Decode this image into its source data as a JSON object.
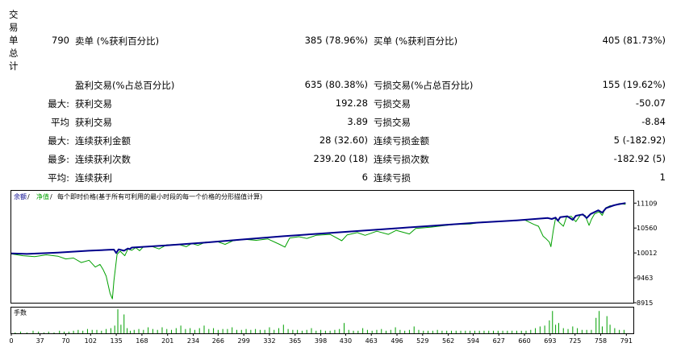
{
  "summary": {
    "vertical_label": [
      "交",
      "易",
      "单",
      "总",
      "计"
    ],
    "total_trades": "790",
    "short_label": "卖单 (%获利百分比)",
    "short_value": "385 (78.96%)",
    "long_label": "买单 (%获利百分比)",
    "long_value": "405 (81.73%)",
    "profit_trades_label": "盈利交易(%占总百分比)",
    "profit_trades_value": "635 (80.38%)",
    "loss_trades_label": "亏损交易(%占总百分比)",
    "loss_trades_value": "155 (19.62%)",
    "rows": [
      {
        "prefix": "最大:",
        "l_label": "获利交易",
        "l_value": "192.28",
        "r_label": "亏损交易",
        "r_value": "-50.07"
      },
      {
        "prefix": "平均",
        "l_label": "获利交易",
        "l_value": "3.89",
        "r_label": "亏损交易",
        "r_value": "-8.84"
      },
      {
        "prefix": "最大:",
        "l_label": "连续获利金额",
        "l_value": "28 (32.60)",
        "r_label": "连续亏损金额",
        "r_value": "5 (-182.92)"
      },
      {
        "prefix": "最多:",
        "l_label": "连续获利次数",
        "l_value": "239.20 (18)",
        "r_label": "连续亏损次数",
        "r_value": "-182.92 (5)"
      },
      {
        "prefix": "平均:",
        "l_label": "连续获利",
        "l_value": "6",
        "r_label": "连续亏损",
        "r_value": "1"
      }
    ]
  },
  "chart_data": [
    {
      "type": "line",
      "legend": {
        "balance": "余额",
        "sep1": " / ",
        "equity": "净值",
        "sep2": " / ",
        "note": "每个即时价格(基于所有可利用的最小时段的每一个价格的分形描值计算)"
      },
      "colors": {
        "balance": "#00008b",
        "equity": "#00a000",
        "axis_text": "#000000",
        "grid": "#c8c8c8"
      },
      "ylim": [
        8915,
        11380
      ],
      "yticks": [
        11109,
        10560,
        10012,
        9463,
        8915
      ],
      "x_range": [
        0,
        800
      ],
      "series": [
        {
          "name": "余额",
          "points": [
            [
              0,
              10000
            ],
            [
              20,
              9990
            ],
            [
              60,
              10020
            ],
            [
              100,
              10060
            ],
            [
              125,
              10080
            ],
            [
              132,
              10085
            ],
            [
              135,
              10010
            ],
            [
              138,
              10090
            ],
            [
              145,
              10060
            ],
            [
              150,
              10110
            ],
            [
              152,
              10095
            ],
            [
              155,
              10130
            ],
            [
              200,
              10180
            ],
            [
              250,
              10240
            ],
            [
              300,
              10310
            ],
            [
              350,
              10380
            ],
            [
              400,
              10440
            ],
            [
              450,
              10500
            ],
            [
              500,
              10560
            ],
            [
              550,
              10620
            ],
            [
              600,
              10680
            ],
            [
              650,
              10730
            ],
            [
              690,
              10780
            ],
            [
              695,
              10760
            ],
            [
              700,
              10790
            ],
            [
              703,
              10720
            ],
            [
              706,
              10800
            ],
            [
              715,
              10820
            ],
            [
              722,
              10740
            ],
            [
              726,
              10830
            ],
            [
              735,
              10860
            ],
            [
              740,
              10780
            ],
            [
              745,
              10870
            ],
            [
              755,
              10950
            ],
            [
              760,
              10900
            ],
            [
              765,
              11000
            ],
            [
              775,
              11060
            ],
            [
              780,
              11080
            ],
            [
              790,
              11110
            ]
          ]
        },
        {
          "name": "净值",
          "points": [
            [
              0,
              9990
            ],
            [
              15,
              9950
            ],
            [
              30,
              9930
            ],
            [
              45,
              9970
            ],
            [
              60,
              9940
            ],
            [
              70,
              9880
            ],
            [
              80,
              9900
            ],
            [
              90,
              9800
            ],
            [
              100,
              9850
            ],
            [
              108,
              9700
            ],
            [
              114,
              9760
            ],
            [
              118,
              9650
            ],
            [
              122,
              9500
            ],
            [
              127,
              9120
            ],
            [
              130,
              9000
            ],
            [
              132,
              9400
            ],
            [
              136,
              9980
            ],
            [
              140,
              10050
            ],
            [
              146,
              9950
            ],
            [
              150,
              10100
            ],
            [
              155,
              10070
            ],
            [
              160,
              10130
            ],
            [
              165,
              10060
            ],
            [
              170,
              10150
            ],
            [
              180,
              10160
            ],
            [
              190,
              10100
            ],
            [
              200,
              10190
            ],
            [
              215,
              10200
            ],
            [
              225,
              10150
            ],
            [
              232,
              10220
            ],
            [
              240,
              10180
            ],
            [
              250,
              10250
            ],
            [
              265,
              10260
            ],
            [
              275,
              10200
            ],
            [
              285,
              10280
            ],
            [
              300,
              10310
            ],
            [
              315,
              10290
            ],
            [
              330,
              10320
            ],
            [
              345,
              10200
            ],
            [
              352,
              10140
            ],
            [
              358,
              10340
            ],
            [
              370,
              10370
            ],
            [
              380,
              10330
            ],
            [
              392,
              10400
            ],
            [
              410,
              10420
            ],
            [
              425,
              10280
            ],
            [
              432,
              10410
            ],
            [
              445,
              10460
            ],
            [
              455,
              10400
            ],
            [
              470,
              10490
            ],
            [
              485,
              10420
            ],
            [
              495,
              10510
            ],
            [
              512,
              10430
            ],
            [
              520,
              10550
            ],
            [
              540,
              10580
            ],
            [
              555,
              10610
            ],
            [
              570,
              10640
            ],
            [
              590,
              10650
            ],
            [
              605,
              10690
            ],
            [
              620,
              10700
            ],
            [
              640,
              10720
            ],
            [
              660,
              10740
            ],
            [
              672,
              10640
            ],
            [
              678,
              10600
            ],
            [
              684,
              10380
            ],
            [
              688,
              10320
            ],
            [
              692,
              10250
            ],
            [
              694,
              10150
            ],
            [
              697,
              10500
            ],
            [
              700,
              10780
            ],
            [
              705,
              10680
            ],
            [
              710,
              10600
            ],
            [
              714,
              10800
            ],
            [
              720,
              10820
            ],
            [
              726,
              10700
            ],
            [
              732,
              10850
            ],
            [
              738,
              10840
            ],
            [
              743,
              10620
            ],
            [
              746,
              10750
            ],
            [
              750,
              10870
            ],
            [
              756,
              10920
            ],
            [
              760,
              10840
            ],
            [
              764,
              11000
            ],
            [
              770,
              11050
            ],
            [
              776,
              11060
            ],
            [
              782,
              11100
            ],
            [
              790,
              11080
            ]
          ]
        }
      ],
      "xticks": [
        "0",
        "37",
        "70",
        "102",
        "135",
        "168",
        "201",
        "234",
        "266",
        "299",
        "332",
        "365",
        "398",
        "430",
        "463",
        "496",
        "529",
        "562",
        "594",
        "627",
        "660",
        "693",
        "725",
        "758",
        "791"
      ]
    },
    {
      "type": "bar",
      "title": "手数",
      "color": "#00a000",
      "bars": [
        [
          5,
          1
        ],
        [
          12,
          2
        ],
        [
          20,
          1
        ],
        [
          28,
          3
        ],
        [
          35,
          2
        ],
        [
          42,
          1
        ],
        [
          48,
          2
        ],
        [
          55,
          1
        ],
        [
          62,
          3
        ],
        [
          68,
          2
        ],
        [
          74,
          2
        ],
        [
          80,
          3
        ],
        [
          86,
          4
        ],
        [
          92,
          3
        ],
        [
          98,
          5
        ],
        [
          104,
          4
        ],
        [
          110,
          4
        ],
        [
          116,
          3
        ],
        [
          122,
          5
        ],
        [
          128,
          6
        ],
        [
          133,
          9
        ],
        [
          137,
          28
        ],
        [
          141,
          10
        ],
        [
          145,
          22
        ],
        [
          149,
          6
        ],
        [
          153,
          3
        ],
        [
          158,
          4
        ],
        [
          164,
          5
        ],
        [
          170,
          4
        ],
        [
          176,
          7
        ],
        [
          182,
          5
        ],
        [
          188,
          4
        ],
        [
          194,
          7
        ],
        [
          200,
          5
        ],
        [
          206,
          4
        ],
        [
          212,
          6
        ],
        [
          218,
          9
        ],
        [
          224,
          5
        ],
        [
          230,
          6
        ],
        [
          236,
          4
        ],
        [
          242,
          6
        ],
        [
          248,
          9
        ],
        [
          254,
          5
        ],
        [
          260,
          6
        ],
        [
          266,
          4
        ],
        [
          272,
          5
        ],
        [
          278,
          5
        ],
        [
          284,
          7
        ],
        [
          290,
          4
        ],
        [
          296,
          4
        ],
        [
          302,
          5
        ],
        [
          308,
          4
        ],
        [
          314,
          5
        ],
        [
          320,
          4
        ],
        [
          326,
          4
        ],
        [
          332,
          7
        ],
        [
          338,
          4
        ],
        [
          344,
          6
        ],
        [
          350,
          10
        ],
        [
          356,
          5
        ],
        [
          362,
          4
        ],
        [
          368,
          4
        ],
        [
          374,
          3
        ],
        [
          380,
          4
        ],
        [
          386,
          6
        ],
        [
          392,
          3
        ],
        [
          398,
          4
        ],
        [
          404,
          3
        ],
        [
          410,
          3
        ],
        [
          416,
          4
        ],
        [
          422,
          5
        ],
        [
          428,
          12
        ],
        [
          434,
          4
        ],
        [
          440,
          3
        ],
        [
          446,
          3
        ],
        [
          452,
          6
        ],
        [
          458,
          4
        ],
        [
          464,
          3
        ],
        [
          470,
          4
        ],
        [
          476,
          5
        ],
        [
          482,
          3
        ],
        [
          488,
          4
        ],
        [
          494,
          7
        ],
        [
          500,
          4
        ],
        [
          506,
          3
        ],
        [
          512,
          4
        ],
        [
          518,
          8
        ],
        [
          524,
          4
        ],
        [
          530,
          3
        ],
        [
          536,
          3
        ],
        [
          542,
          3
        ],
        [
          548,
          4
        ],
        [
          554,
          3
        ],
        [
          560,
          3
        ],
        [
          566,
          3
        ],
        [
          572,
          3
        ],
        [
          578,
          3
        ],
        [
          584,
          3
        ],
        [
          590,
          3
        ],
        [
          596,
          3
        ],
        [
          602,
          3
        ],
        [
          608,
          3
        ],
        [
          614,
          3
        ],
        [
          620,
          3
        ],
        [
          626,
          3
        ],
        [
          632,
          3
        ],
        [
          638,
          3
        ],
        [
          644,
          3
        ],
        [
          650,
          3
        ],
        [
          656,
          3
        ],
        [
          662,
          3
        ],
        [
          668,
          4
        ],
        [
          674,
          6
        ],
        [
          680,
          8
        ],
        [
          686,
          9
        ],
        [
          692,
          15
        ],
        [
          696,
          26
        ],
        [
          700,
          10
        ],
        [
          704,
          12
        ],
        [
          710,
          6
        ],
        [
          716,
          5
        ],
        [
          722,
          8
        ],
        [
          728,
          6
        ],
        [
          734,
          4
        ],
        [
          740,
          4
        ],
        [
          746,
          4
        ],
        [
          752,
          18
        ],
        [
          756,
          26
        ],
        [
          760,
          8
        ],
        [
          766,
          20
        ],
        [
          770,
          10
        ],
        [
          776,
          6
        ],
        [
          782,
          4
        ],
        [
          788,
          4
        ]
      ],
      "ylim": [
        0,
        30
      ]
    }
  ]
}
